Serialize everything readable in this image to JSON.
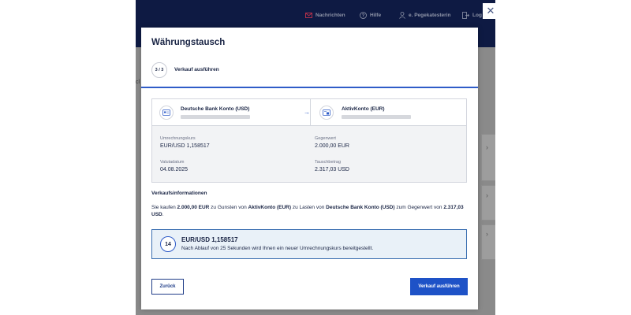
{
  "nav": {
    "messages": "Nachrichten",
    "help": "Hilfe",
    "user": "e. Pegekatesterin",
    "logout": "Log"
  },
  "background": {
    "left_fragment": "cl"
  },
  "modal": {
    "title": "Währungstausch",
    "step": "3 / 3",
    "step_label": "Verkauf ausführen",
    "from_account": "Deutsche Bank Konto (USD)",
    "to_account": "AktivKonto (EUR)",
    "rate_label": "Umrechnungskurs",
    "rate_value": "EUR/USD 1,158517",
    "counter_label": "Gegenwert",
    "counter_value": "2.000,00 EUR",
    "value_date_label": "Valutadatum",
    "value_date_value": "04.08.2025",
    "exchange_amount_label": "Tauschbetrag",
    "exchange_amount_value": "2.317,03 USD",
    "sales_info_title": "Verkaufsinformationen",
    "sales_text": {
      "p1": "Sie kaufen ",
      "amount_eur": "2.000,00 EUR",
      "p2": " zu Gunsten von ",
      "to": "AktivKonto (EUR)",
      "p3": " zu Lasten von ",
      "from": "Deutsche Bank Konto (USD)",
      "p4": " zum Gegenwert von ",
      "amount_usd": "2.317,03 USD",
      "p5": "."
    },
    "countdown": "14",
    "banner_rate": "EUR/USD 1,158517",
    "banner_note": "Nach Ablauf von 25 Sekunden wird Ihnen ein neuer Umrechnungskurs bereitgestellt.",
    "back_label": "Zurück",
    "execute_label": "Verkauf ausführen"
  },
  "colors": {
    "primary": "#1e52c7",
    "nav_bg": "#0e1a43",
    "banner_bg": "#e9f1f8"
  }
}
